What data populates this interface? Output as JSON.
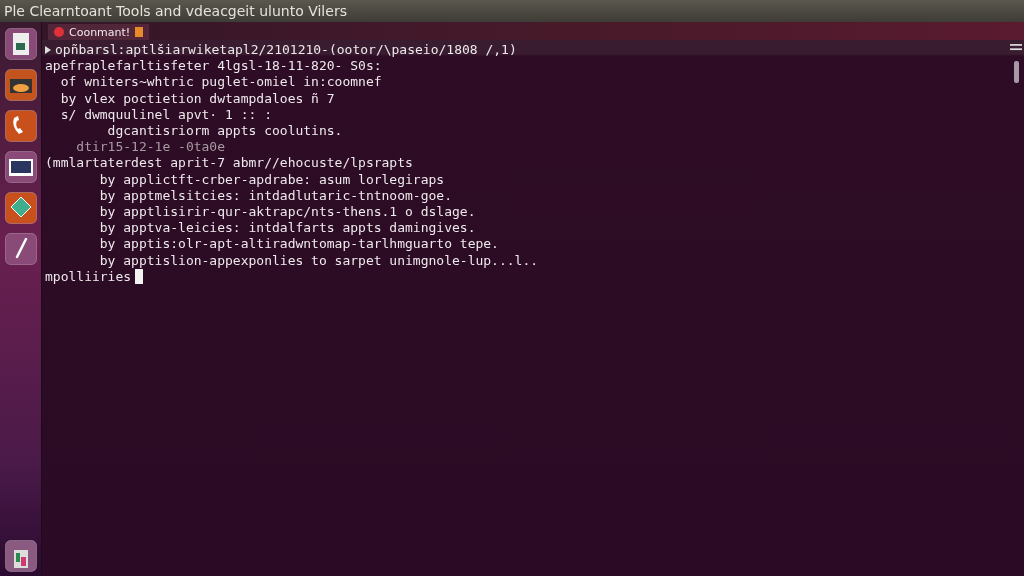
{
  "window": {
    "title": "Ple Clearntoant Tools and vdeacgeit ulunto Vilers"
  },
  "launcher": {
    "items": [
      {
        "kind": "file"
      },
      {
        "kind": "photo"
      },
      {
        "kind": "phone"
      },
      {
        "kind": "screen"
      },
      {
        "kind": "leaf"
      },
      {
        "kind": "tool"
      }
    ],
    "bottom": {
      "kind": "trash"
    }
  },
  "tabs": [
    {
      "label": "Coonmant!",
      "selected": true
    }
  ],
  "terminal": {
    "prompt_line": "opñbarsl:aptlšiarwiketapl2/2101210-(ootor/\\paseio/1808 /,1)",
    "lines": [
      {
        "kind": "output",
        "text": "apefraplefarltisfeter 4lgsl-18-11-820- S0s:"
      },
      {
        "kind": "output",
        "text": "  of wniters~whtric puglet-omiel in:coomnef"
      },
      {
        "kind": "output",
        "text": "  by vlex poctietion dwtampdaloes ñ 7"
      },
      {
        "kind": "output",
        "text": "  s/ dwmquulinel apvt· 1 :: :"
      },
      {
        "kind": "output",
        "text": "        dgcantisriorm appts coolutins."
      },
      {
        "kind": "dim",
        "text": "    dtir15-12-1e -0ta0e"
      },
      {
        "kind": "output",
        "text": "(mmlartaterdest aprit-7 abmr//ehocuste/lpsrapts"
      },
      {
        "kind": "output",
        "text": "       by applictft-crber-apdrabe: asum lorlegiraps"
      },
      {
        "kind": "output",
        "text": "       by apptmelsitcies: intdadlutaric-tntnoom-goe."
      },
      {
        "kind": "output",
        "text": "       by apptlisirir-qur-aktrapc/nts-thens.1 o dslage."
      },
      {
        "kind": "output",
        "text": "       by apptva-leicies: intdalfarts appts damingives."
      },
      {
        "kind": "output",
        "text": "       by apptis:olr-apt-altiradwntomap-tarlhmguarto tepe."
      },
      {
        "kind": "output",
        "text": "       by apptislion-appexponlies to sarpet unimgnole-lup...l.."
      }
    ],
    "input_line": "mpolliiries"
  }
}
